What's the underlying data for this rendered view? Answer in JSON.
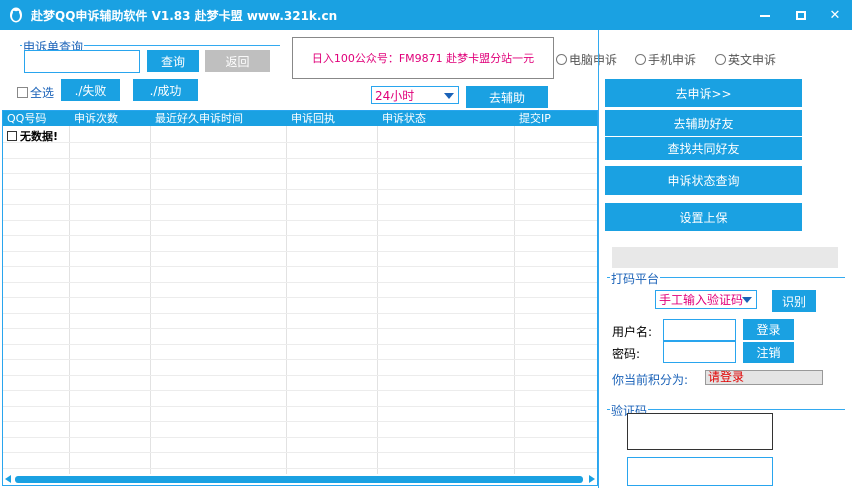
{
  "window": {
    "title": "赴梦QQ申诉辅助软件 V1.83   赴梦卡盟 www.321k.cn",
    "minimize": "minimize",
    "maximize": "maximize",
    "close": "✕"
  },
  "query": {
    "group_label": "申诉单查询",
    "input_value": "",
    "query_button": "查询",
    "back_button": "返回"
  },
  "banner": {
    "text": "日入100公众号：FM9871 赴梦卡盟分站一元"
  },
  "modes": {
    "items": [
      {
        "label": "电脑申诉",
        "selected": false
      },
      {
        "label": "手机申诉",
        "selected": false
      },
      {
        "label": "英文申诉",
        "selected": false
      }
    ]
  },
  "list_actions": {
    "select_all": "全选",
    "fail_button": "./失败",
    "success_button": "./成功"
  },
  "assist": {
    "interval_value": "24小时",
    "go_assist_button": "去辅助"
  },
  "table": {
    "columns": [
      "QQ号码",
      "申诉次数",
      "最近好久申诉时间",
      "申诉回执",
      "申诉状态",
      "提交IP"
    ],
    "empty_text": "无数据!"
  },
  "actions": {
    "go_appeal": "去申诉>>",
    "assist_friends": "去辅助好友",
    "find_common_friends": "查找共同好友",
    "status_query": "申诉状态查询",
    "set_protection": "设置上保"
  },
  "captcha_platform": {
    "group_label": "打码平台",
    "method_value": "手工输入验证码",
    "recognize_button": "识别",
    "username_label": "用户名:",
    "password_label": "密码:",
    "username_value": "",
    "password_value": "",
    "login_button": "登录",
    "logout_button": "注销",
    "points_label": "你当前积分为:",
    "points_value": "请登录"
  },
  "verify": {
    "group_label": "验证码",
    "input_value": ""
  },
  "colors": {
    "accent": "#1aa1e2",
    "banner_text": "#e0007a",
    "status_red": "#e00000"
  }
}
